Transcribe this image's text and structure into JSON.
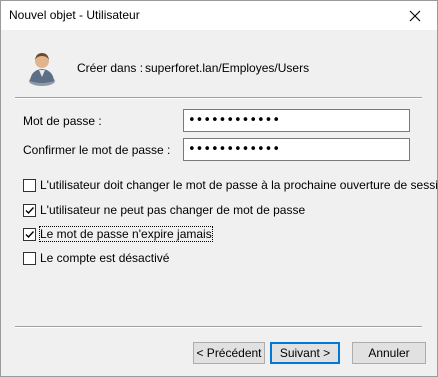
{
  "window": {
    "title": "Nouvel objet - Utilisateur",
    "close_icon": "close-icon"
  },
  "header": {
    "icon": "user-icon",
    "create_label": "Créer dans :",
    "create_path": "superforet.lan/Employes/Users"
  },
  "password": {
    "label": "Mot de passe :",
    "value": "••••••••••••"
  },
  "confirm": {
    "label": "Confirmer le mot de passe :",
    "value": "••••••••••••"
  },
  "options": [
    {
      "label": "L'utilisateur doit changer le mot de passe à la prochaine ouverture de session",
      "checked": false
    },
    {
      "label": "L'utilisateur ne peut pas changer de mot de passe",
      "checked": true
    },
    {
      "label": "Le mot de passe n'expire jamais",
      "checked": true
    },
    {
      "label": "Le compte est désactivé",
      "checked": false
    }
  ],
  "buttons": {
    "back": "< Précédent",
    "next": "Suivant >",
    "cancel": "Annuler"
  }
}
